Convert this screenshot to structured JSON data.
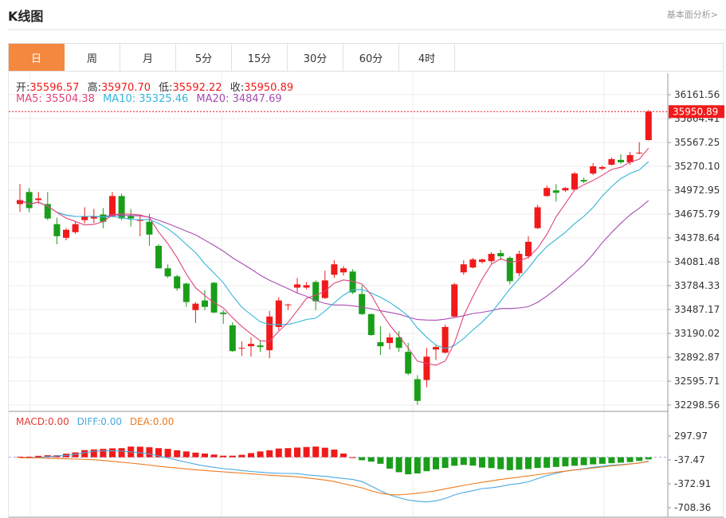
{
  "header": {
    "title": "K线图",
    "link": "基本面分析>"
  },
  "tabs": [
    {
      "label": "日",
      "active": true
    },
    {
      "label": "周",
      "active": false
    },
    {
      "label": "月",
      "active": false
    },
    {
      "label": "5分",
      "active": false
    },
    {
      "label": "15分",
      "active": false
    },
    {
      "label": "30分",
      "active": false
    },
    {
      "label": "60分",
      "active": false
    },
    {
      "label": "4时",
      "active": false
    }
  ],
  "ohlc_info": {
    "open_label": "开:",
    "open": "35596.57",
    "high_label": "高:",
    "high": "35970.70",
    "low_label": "低:",
    "low": "35592.22",
    "close_label": "收:",
    "close": "35950.89"
  },
  "ma_info": {
    "ma5_label": "MA5:",
    "ma5": "35504.38",
    "ma10_label": "MA10:",
    "ma10": "35325.46",
    "ma20_label": "MA20:",
    "ma20": "34847.69"
  },
  "macd_info": {
    "macd_label": "MACD:",
    "macd": "0.00",
    "diff_label": "DIFF:",
    "diff": "0.00",
    "dea_label": "DEA:",
    "dea": "0.00"
  },
  "colors": {
    "up": "#f01a1a",
    "down": "#1a9e1a",
    "ma5": "#e0457a",
    "ma10": "#33b6d9",
    "ma20": "#a64db3",
    "diff": "#4aa8e0",
    "dea": "#f07a1e",
    "accent": "#f5883f"
  },
  "chart_data": {
    "type": "candlestick",
    "price_axis": {
      "ylim": [
        32298.56,
        36161.56
      ],
      "ticks": [
        "36161.56",
        "35864.41",
        "35567.25",
        "35270.10",
        "34972.95",
        "34675.79",
        "34378.64",
        "34081.48",
        "33784.33",
        "33487.17",
        "33190.02",
        "32892.87",
        "32595.71",
        "32298.56"
      ]
    },
    "last_price": "35950.89",
    "candles": [
      {
        "o": 34800,
        "h": 35050,
        "l": 34700,
        "c": 34850
      },
      {
        "o": 34950,
        "h": 35000,
        "l": 34700,
        "c": 34750
      },
      {
        "o": 34850,
        "h": 34950,
        "l": 34800,
        "c": 34870
      },
      {
        "o": 34800,
        "h": 34950,
        "l": 34600,
        "c": 34620
      },
      {
        "o": 34550,
        "h": 34630,
        "l": 34300,
        "c": 34400
      },
      {
        "o": 34380,
        "h": 34500,
        "l": 34350,
        "c": 34480
      },
      {
        "o": 34450,
        "h": 34580,
        "l": 34430,
        "c": 34550
      },
      {
        "o": 34600,
        "h": 34760,
        "l": 34560,
        "c": 34650
      },
      {
        "o": 34620,
        "h": 34740,
        "l": 34560,
        "c": 34650
      },
      {
        "o": 34670,
        "h": 34750,
        "l": 34500,
        "c": 34580
      },
      {
        "o": 34650,
        "h": 34950,
        "l": 34640,
        "c": 34900
      },
      {
        "o": 34900,
        "h": 34930,
        "l": 34600,
        "c": 34620
      },
      {
        "o": 34650,
        "h": 34740,
        "l": 34520,
        "c": 34620
      },
      {
        "o": 34600,
        "h": 34670,
        "l": 34400,
        "c": 34600
      },
      {
        "o": 34580,
        "h": 34680,
        "l": 34280,
        "c": 34420
      },
      {
        "o": 34280,
        "h": 34300,
        "l": 34000,
        "c": 34000
      },
      {
        "o": 34000,
        "h": 34050,
        "l": 33880,
        "c": 33900
      },
      {
        "o": 33900,
        "h": 33920,
        "l": 33720,
        "c": 33750
      },
      {
        "o": 33810,
        "h": 33820,
        "l": 33520,
        "c": 33580
      },
      {
        "o": 33480,
        "h": 33580,
        "l": 33320,
        "c": 33560
      },
      {
        "o": 33600,
        "h": 33730,
        "l": 33480,
        "c": 33520
      },
      {
        "o": 33820,
        "h": 33830,
        "l": 33440,
        "c": 33450
      },
      {
        "o": 33450,
        "h": 33480,
        "l": 33310,
        "c": 33430
      },
      {
        "o": 33290,
        "h": 33330,
        "l": 32960,
        "c": 32970
      },
      {
        "o": 33000,
        "h": 33090,
        "l": 32910,
        "c": 33010
      },
      {
        "o": 33030,
        "h": 33140,
        "l": 32900,
        "c": 33060
      },
      {
        "o": 33040,
        "h": 33100,
        "l": 32960,
        "c": 33020
      },
      {
        "o": 32980,
        "h": 33470,
        "l": 32880,
        "c": 33400
      },
      {
        "o": 33270,
        "h": 33640,
        "l": 33230,
        "c": 33600
      },
      {
        "o": 33540,
        "h": 33560,
        "l": 33480,
        "c": 33550
      },
      {
        "o": 33760,
        "h": 33880,
        "l": 33700,
        "c": 33800
      },
      {
        "o": 33760,
        "h": 33830,
        "l": 33740,
        "c": 33790
      },
      {
        "o": 33830,
        "h": 33850,
        "l": 33480,
        "c": 33590
      },
      {
        "o": 33630,
        "h": 33970,
        "l": 33620,
        "c": 33850
      },
      {
        "o": 33920,
        "h": 34100,
        "l": 33880,
        "c": 34050
      },
      {
        "o": 33950,
        "h": 34030,
        "l": 33910,
        "c": 34000
      },
      {
        "o": 33960,
        "h": 33990,
        "l": 33680,
        "c": 33700
      },
      {
        "o": 33680,
        "h": 33790,
        "l": 33420,
        "c": 33430
      },
      {
        "o": 33430,
        "h": 33440,
        "l": 33160,
        "c": 33170
      },
      {
        "o": 33080,
        "h": 33280,
        "l": 32920,
        "c": 33030
      },
      {
        "o": 33070,
        "h": 33190,
        "l": 32990,
        "c": 33140
      },
      {
        "o": 33140,
        "h": 33220,
        "l": 32960,
        "c": 33010
      },
      {
        "o": 32960,
        "h": 33070,
        "l": 32670,
        "c": 32690
      },
      {
        "o": 32620,
        "h": 32670,
        "l": 32300,
        "c": 32350
      },
      {
        "o": 32610,
        "h": 33010,
        "l": 32520,
        "c": 32900
      },
      {
        "o": 32990,
        "h": 33040,
        "l": 32860,
        "c": 33020
      },
      {
        "o": 32950,
        "h": 33300,
        "l": 32940,
        "c": 33270
      },
      {
        "o": 33400,
        "h": 33820,
        "l": 33390,
        "c": 33800
      },
      {
        "o": 33950,
        "h": 34100,
        "l": 33920,
        "c": 34050
      },
      {
        "o": 34010,
        "h": 34130,
        "l": 34000,
        "c": 34110
      },
      {
        "o": 34080,
        "h": 34120,
        "l": 34060,
        "c": 34110
      },
      {
        "o": 34090,
        "h": 34200,
        "l": 34060,
        "c": 34180
      },
      {
        "o": 34190,
        "h": 34230,
        "l": 34100,
        "c": 34150
      },
      {
        "o": 34130,
        "h": 34150,
        "l": 33800,
        "c": 33840
      },
      {
        "o": 33940,
        "h": 34220,
        "l": 33900,
        "c": 34180
      },
      {
        "o": 34150,
        "h": 34400,
        "l": 34120,
        "c": 34330
      },
      {
        "o": 34500,
        "h": 34790,
        "l": 34490,
        "c": 34760
      },
      {
        "o": 34900,
        "h": 35030,
        "l": 34890,
        "c": 35000
      },
      {
        "o": 34970,
        "h": 35050,
        "l": 34830,
        "c": 34940
      },
      {
        "o": 34970,
        "h": 35010,
        "l": 34950,
        "c": 35000
      },
      {
        "o": 34980,
        "h": 35200,
        "l": 34970,
        "c": 35180
      },
      {
        "o": 35100,
        "h": 35130,
        "l": 35060,
        "c": 35080
      },
      {
        "o": 35180,
        "h": 35310,
        "l": 35160,
        "c": 35270
      },
      {
        "o": 35240,
        "h": 35280,
        "l": 35220,
        "c": 35260
      },
      {
        "o": 35290,
        "h": 35380,
        "l": 35280,
        "c": 35360
      },
      {
        "o": 35350,
        "h": 35420,
        "l": 35300,
        "c": 35320
      },
      {
        "o": 35320,
        "h": 35450,
        "l": 35290,
        "c": 35410
      },
      {
        "o": 35430,
        "h": 35570,
        "l": 35420,
        "c": 35440
      },
      {
        "o": 35596.57,
        "h": 35970.7,
        "l": 35592.22,
        "c": 35950.89
      }
    ],
    "macd_axis": {
      "ylim": [
        -708.36,
        448
      ],
      "ticks": [
        "297.97",
        "-37.47",
        "-372.91",
        "-708.36"
      ]
    },
    "macd_hist": [
      8,
      8,
      20,
      28,
      28,
      50,
      68,
      100,
      110,
      118,
      125,
      128,
      150,
      148,
      140,
      128,
      118,
      98,
      82,
      65,
      52,
      38,
      22,
      22,
      34,
      58,
      82,
      98,
      122,
      128,
      136,
      144,
      150,
      134,
      108,
      52,
      0,
      -42,
      -62,
      -92,
      -160,
      -210,
      -240,
      -228,
      -196,
      -170,
      -150,
      -120,
      -108,
      -118,
      -145,
      -152,
      -168,
      -182,
      -174,
      -166,
      -150,
      -148,
      -136,
      -128,
      -120,
      -112,
      -100,
      -92,
      -84,
      -76,
      -68,
      -52,
      -30
    ],
    "macd_diff": [
      -10,
      -8,
      -4,
      8,
      18,
      26,
      40,
      65,
      85,
      90,
      92,
      86,
      76,
      64,
      46,
      18,
      -10,
      -40,
      -70,
      -98,
      -124,
      -142,
      -160,
      -170,
      -186,
      -200,
      -210,
      -220,
      -225,
      -228,
      -230,
      -248,
      -258,
      -268,
      -285,
      -298,
      -312,
      -342,
      -405,
      -470,
      -530,
      -568,
      -602,
      -618,
      -628,
      -612,
      -580,
      -530,
      -495,
      -470,
      -440,
      -430,
      -410,
      -385,
      -370,
      -345,
      -300,
      -258,
      -228,
      -195,
      -178,
      -160,
      -140,
      -126,
      -112,
      -104,
      -92,
      -82,
      -52
    ],
    "macd_dea": [
      -8,
      -9,
      -10,
      -14,
      -18,
      -22,
      -26,
      -30,
      -35,
      -45,
      -58,
      -70,
      -82,
      -96,
      -110,
      -126,
      -140,
      -152,
      -164,
      -176,
      -186,
      -196,
      -205,
      -214,
      -222,
      -232,
      -244,
      -252,
      -260,
      -268,
      -276,
      -290,
      -305,
      -320,
      -342,
      -372,
      -400,
      -430,
      -472,
      -505,
      -525,
      -528,
      -518,
      -505,
      -490,
      -470,
      -445,
      -420,
      -395,
      -373,
      -352,
      -332,
      -312,
      -296,
      -278,
      -262,
      -244,
      -228,
      -210,
      -196,
      -180,
      -166,
      -150,
      -138,
      -122,
      -110,
      -96,
      -80,
      -60
    ]
  }
}
